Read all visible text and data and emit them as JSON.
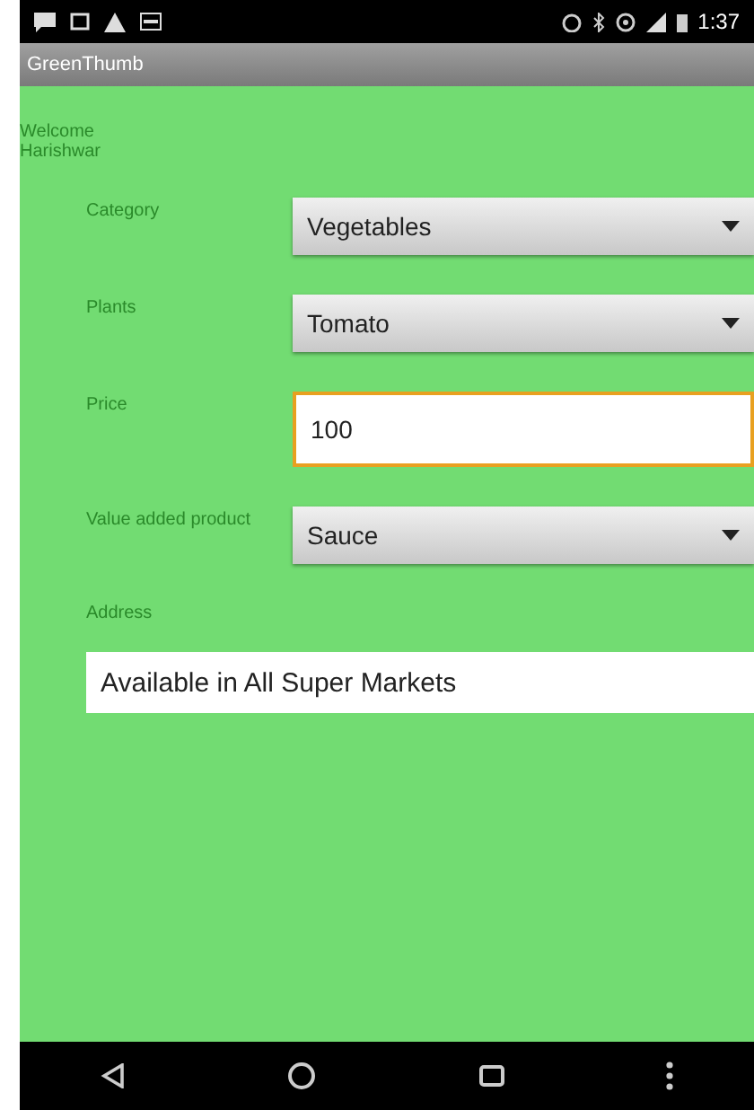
{
  "status_bar": {
    "time": "1:37"
  },
  "app_bar": {
    "title": "GreenThumb"
  },
  "welcome": [
    "Welcome",
    "Harishwar"
  ],
  "fields": [
    {
      "kind": "spinner",
      "label": "Category",
      "value": "Vegetables"
    },
    {
      "kind": "spinner",
      "label": "Plants",
      "value": "Tomato"
    },
    {
      "kind": "text",
      "label": "Price",
      "value": "100",
      "focused": true
    },
    {
      "kind": "spinner",
      "label": "Value added product",
      "value": "Sauce"
    }
  ],
  "address": {
    "label": "Address",
    "value": "Available in All Super Markets",
    "focused": false
  }
}
